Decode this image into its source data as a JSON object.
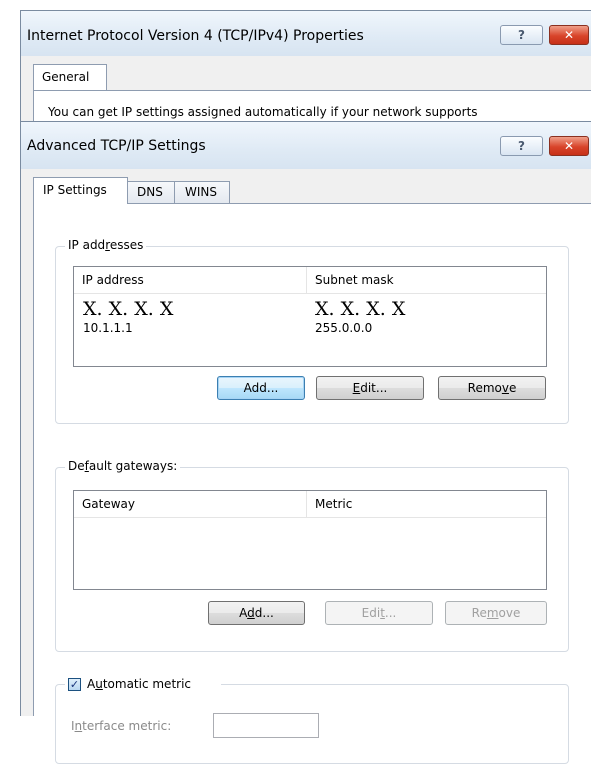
{
  "back_window": {
    "title": "Internet Protocol Version 4 (TCP/IPv4) Properties",
    "tab_general": "General",
    "body_text": "You can get IP settings assigned automatically if your network supports",
    "help_glyph": "?",
    "close_glyph": "✕"
  },
  "front_window": {
    "title": "Advanced TCP/IP Settings",
    "help_glyph": "?",
    "close_glyph": "✕",
    "tabs": [
      {
        "label": "IP Settings",
        "active": true
      },
      {
        "label": "DNS",
        "active": false
      },
      {
        "label": "WINS",
        "active": false
      }
    ],
    "ip_addresses": {
      "group_title_pre": "IP add",
      "group_title_u": "r",
      "group_title_post": "esses",
      "col_ip": "IP address",
      "col_mask": "Subnet mask",
      "rows": [
        {
          "ip_placeholder": "X. X. X. X",
          "ip": "10.1.1.1",
          "mask_placeholder": "X. X. X. X",
          "mask": "255.0.0.0"
        }
      ],
      "add_label": "Add...",
      "edit_pre": "",
      "edit_u": "E",
      "edit_post": "dit...",
      "remove_pre": "Remo",
      "remove_u": "v",
      "remove_post": "e"
    },
    "gateways": {
      "group_title_pre": "De",
      "group_title_u": "f",
      "group_title_post": "ault gateways:",
      "col_gateway": "Gateway",
      "col_metric": "Metric",
      "add_pre": "A",
      "add_u": "d",
      "add_post": "d...",
      "edit_pre": "Edi",
      "edit_u": "t",
      "edit_post": "...",
      "remove_pre": "Re",
      "remove_u": "m",
      "remove_post": "ove"
    },
    "metric": {
      "checkbox_checked": true,
      "check_glyph": "✓",
      "label_pre": "A",
      "label_u": "u",
      "label_post": "tomatic metric",
      "interface_pre": "I",
      "interface_u": "n",
      "interface_post": "terface metric:",
      "interface_value": ""
    }
  },
  "colors": {
    "window_frame": "#7a8ba0",
    "titlebar": "#dfeaf5",
    "close_button": "#d8442a",
    "default_button_border": "#3c7fb1"
  }
}
